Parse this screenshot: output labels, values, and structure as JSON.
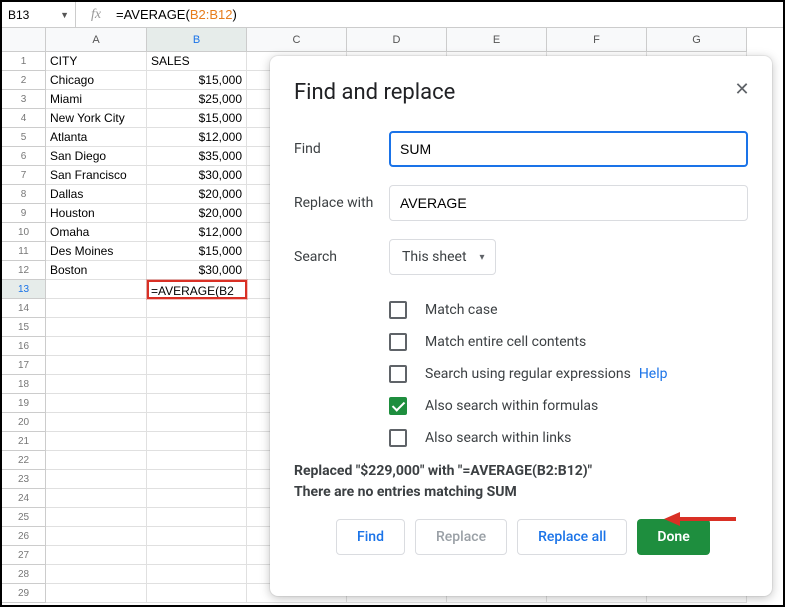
{
  "formula_bar": {
    "cell_ref": "B13",
    "formula_prefix": "=AVERAGE(",
    "formula_range": "B2:B12",
    "formula_suffix": ")"
  },
  "columns": [
    "A",
    "B",
    "C",
    "D",
    "E",
    "F",
    "G"
  ],
  "rows_count": 29,
  "active_row": 13,
  "active_col_index": 1,
  "table": {
    "headers": {
      "A": "CITY",
      "B": "SALES"
    },
    "rows": [
      {
        "A": "Chicago",
        "B": "$15,000"
      },
      {
        "A": "Miami",
        "B": "$25,000"
      },
      {
        "A": "New York City",
        "B": "$15,000"
      },
      {
        "A": "Atlanta",
        "B": "$12,000"
      },
      {
        "A": "San Diego",
        "B": "$35,000"
      },
      {
        "A": "San Francisco",
        "B": "$30,000"
      },
      {
        "A": "Dallas",
        "B": "$20,000"
      },
      {
        "A": "Houston",
        "B": "$20,000"
      },
      {
        "A": "Omaha",
        "B": "$12,000"
      },
      {
        "A": "Des Moines",
        "B": "$15,000"
      },
      {
        "A": "Boston",
        "B": "$30,000"
      }
    ],
    "selected_cell_text": "=AVERAGE(B2"
  },
  "dialog": {
    "title": "Find and replace",
    "find_label": "Find",
    "find_value": "SUM",
    "replace_label": "Replace with",
    "replace_value": "AVERAGE",
    "search_label": "Search",
    "search_scope": "This sheet",
    "options": {
      "match_case": {
        "label": "Match case",
        "checked": false
      },
      "entire_cell": {
        "label": "Match entire cell contents",
        "checked": false
      },
      "regex": {
        "label": "Search using regular expressions",
        "checked": false,
        "help": "Help"
      },
      "formulas": {
        "label": "Also search within formulas",
        "checked": true
      },
      "links": {
        "label": "Also search within links",
        "checked": false
      }
    },
    "status_line1": "Replaced \"$229,000\" with \"=AVERAGE(B2:B12)\"",
    "status_line2": "There are no entries matching SUM",
    "buttons": {
      "find": "Find",
      "replace": "Replace",
      "replace_all": "Replace all",
      "done": "Done"
    }
  }
}
